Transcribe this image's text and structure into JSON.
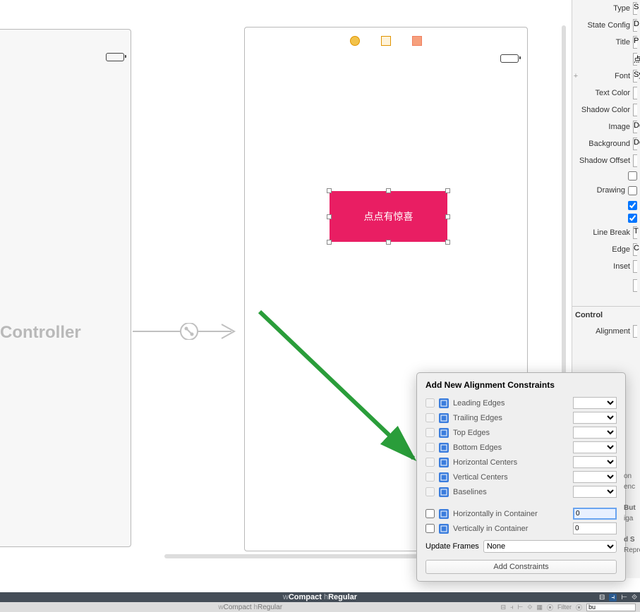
{
  "left_vc_title": "Controller",
  "button_text": "点点有惊喜",
  "inspector": {
    "type_label": "Type",
    "type_val": "S",
    "state_label": "State Config",
    "state_val": "D",
    "title_label": "Title",
    "title_val": "P",
    "title_text": "点",
    "font_label": "Font",
    "font_val": "Sy",
    "textcolor_label": "Text Color",
    "shadowcolor_label": "Shadow Color",
    "image_label": "Image",
    "image_val": "De",
    "background_label": "Background",
    "background_val": "De",
    "shadowoffset_label": "Shadow Offset",
    "drawing_label": "Drawing",
    "linebreak_label": "Line Break",
    "linebreak_val": "T",
    "edge_label": "Edge",
    "edge_val": "C",
    "inset_label": "Inset",
    "control_header": "Control",
    "alignment_label": "Alignment"
  },
  "popover": {
    "title": "Add New Alignment Constraints",
    "items": [
      {
        "label": "Leading Edges"
      },
      {
        "label": "Trailing Edges"
      },
      {
        "label": "Top Edges"
      },
      {
        "label": "Bottom Edges"
      },
      {
        "label": "Horizontal Centers"
      },
      {
        "label": "Vertical Centers"
      },
      {
        "label": "Baselines"
      }
    ],
    "container": [
      {
        "label": "Horizontally in Container",
        "value": "0",
        "hl": true
      },
      {
        "label": "Vertically in Container",
        "value": "0",
        "hl": false
      }
    ],
    "update_label": "Update Frames",
    "update_value": "None",
    "add_label": "Add Constraints"
  },
  "bottom": {
    "w": "w",
    "compact": "Compact",
    "h": "h",
    "regular": "Regular",
    "filter_label": "Filter",
    "filter_value": "bu"
  },
  "hidden": {
    "on": "on",
    "enc": "enc",
    "but": "But",
    "iga": "iga",
    "ds": "d S",
    "rep": "Represe"
  }
}
